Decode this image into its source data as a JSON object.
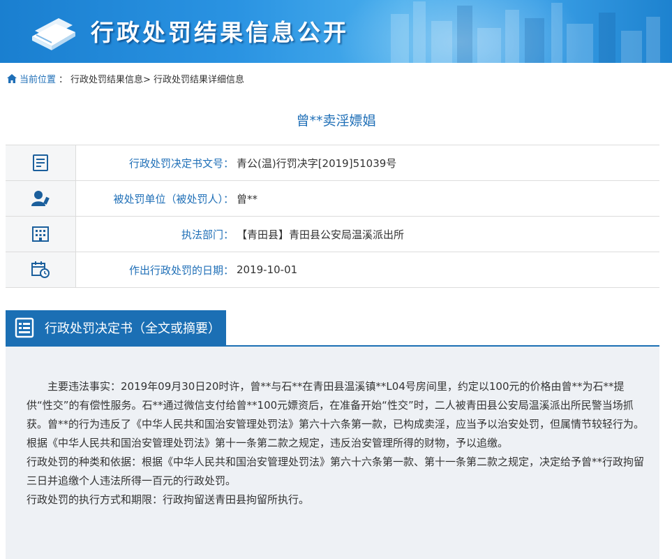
{
  "banner": {
    "title": "行政处罚结果信息公开",
    "logo_icon": "book-icon"
  },
  "breadcrumb": {
    "icon": "home-icon",
    "current_label": "当前位置",
    "separator": "：",
    "item1": "行政处罚结果信息>",
    "item2": "行政处罚结果详细信息"
  },
  "case_title": "曾**卖淫嫖娼",
  "info_rows": [
    {
      "icon": "document-icon",
      "label": "行政处罚决定书文号：",
      "value": "青公(温)行罚决字[2019]51039号"
    },
    {
      "icon": "person-icon",
      "label": "被处罚单位（被处罚人）：",
      "value": "曾**"
    },
    {
      "icon": "building-icon",
      "label": "执法部门：",
      "value": "【青田县】青田县公安局温溪派出所"
    },
    {
      "icon": "calendar-clock-icon",
      "label": "作出行政处罚的日期：",
      "value": "2019-10-01"
    }
  ],
  "section": {
    "icon": "document-list-icon",
    "title": "行政处罚决定书（全文或摘要）"
  },
  "content": {
    "p1": "主要违法事实：2019年09月30日20时许，曾**与石**在青田县温溪镇**L04号房间里，约定以100元的价格由曾**为石**提供“性交”的有偿性服务。石**通过微信支付给曾**100元嫖资后，在准备开始“性交”时，二人被青田县公安局温溪派出所民警当场抓获。曾**的行为违反了《中华人民共和国治安管理处罚法》第六十六条第一款，已构成卖淫，应当予以治安处罚，但属情节较轻行为。根据《中华人民共和国治安管理处罚法》第十一条第二款之规定，违反治安管理所得的财物，予以追缴。",
    "p2": "行政处罚的种类和依据：根据《中华人民共和国治安管理处罚法》第六十六条第一款、第十一条第二款之规定，决定给予曾**行政拘留三日并追缴个人违法所得一百元的行政处罚。",
    "p3": "行政处罚的执行方式和期限：行政拘留送青田县拘留所执行。"
  },
  "colors": {
    "accent": "#1b6fb4",
    "label_blue": "#1f6fb7",
    "content_bg": "#eef1f5"
  }
}
